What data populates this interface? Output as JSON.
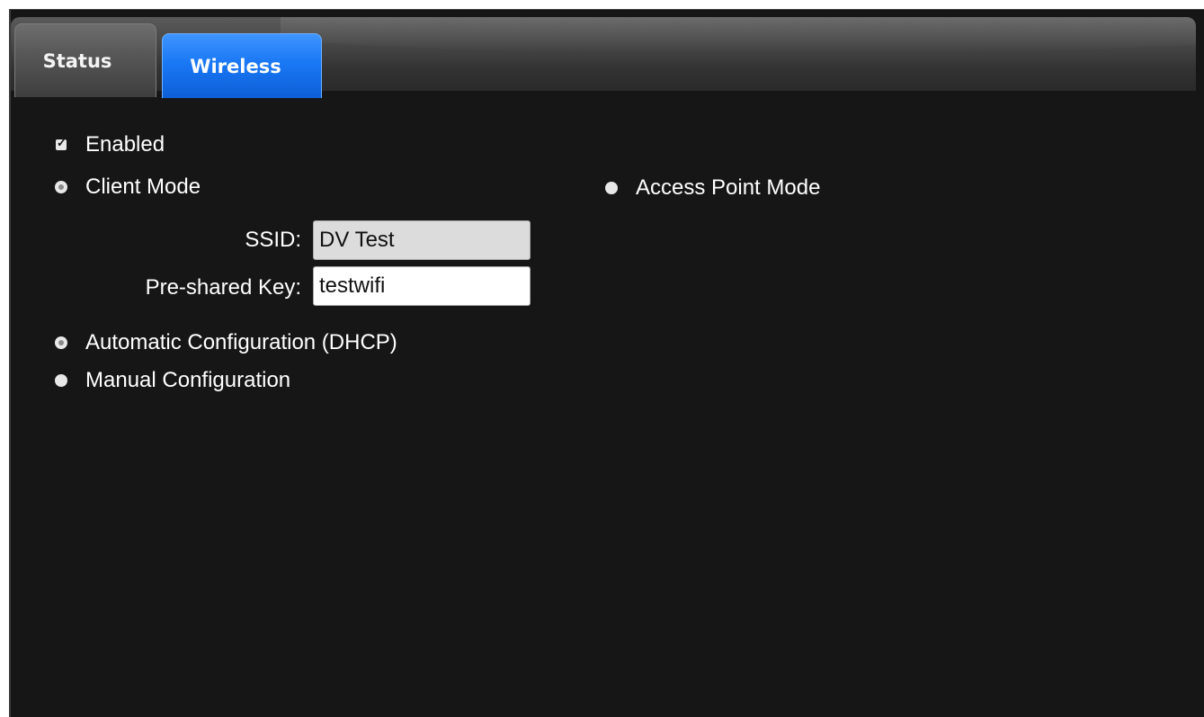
{
  "tabs": [
    {
      "label": "Status",
      "active": false
    },
    {
      "label": "Wireless",
      "active": true
    }
  ],
  "enabled": {
    "label": "Enabled",
    "checked": true
  },
  "mode": {
    "client_label": "Client Mode",
    "access_point_label": "Access Point Mode",
    "selected": "client"
  },
  "ssid": {
    "label": "SSID:",
    "value": "DV Test"
  },
  "psk": {
    "label": "Pre-shared Key:",
    "value": "testwifi"
  },
  "config": {
    "dhcp_label": "Automatic Configuration (DHCP)",
    "manual_label": "Manual Configuration",
    "selected": "dhcp"
  },
  "colors": {
    "background": "#161616",
    "tab_active": "#1a78f5",
    "tab_inactive": "#585858",
    "text": "#ffffff"
  },
  "icons": {
    "checkbox": "checkbox-checked-icon",
    "radio_selected": "radio-selected-icon",
    "radio_unselected": "radio-unselected-icon"
  }
}
